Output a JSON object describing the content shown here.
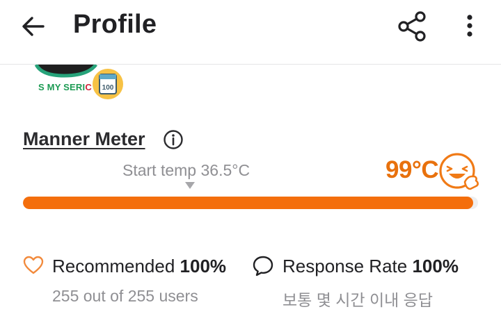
{
  "header": {
    "title": "Profile"
  },
  "profile": {
    "badge_text": "100",
    "avatar_caption_green": "S MY SERI",
    "avatar_caption_red": "C"
  },
  "manner": {
    "title": "Manner Meter",
    "start_label": "Start temp 36.5°C",
    "temperature": "99°C",
    "fill_fraction": 0.99,
    "bar_color": "#f46e0c"
  },
  "stats": {
    "recommended": {
      "label": "Recommended",
      "value": "100%",
      "sub": "255 out of 255 users"
    },
    "response": {
      "label": "Response Rate",
      "value": "100%",
      "sub": "보통 몇 시간 이내 응답"
    }
  },
  "colors": {
    "accent": "#f46e0c",
    "temp_text": "#e8710d"
  },
  "icons": [
    "back-arrow-icon",
    "share-icon",
    "more-vertical-icon",
    "info-icon",
    "happy-face-thumbs-up-icon",
    "heart-icon",
    "speech-bubble-icon",
    "hundred-badge-icon"
  ]
}
